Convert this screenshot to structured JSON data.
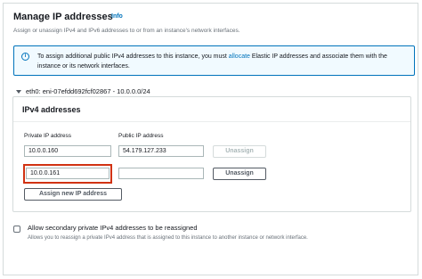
{
  "header": {
    "title": "Manage IP addresses",
    "info_link": "Info",
    "description": "Assign or unassign IPv4 and IPv6 addresses to or from an instance's network interfaces."
  },
  "info_alert": {
    "text_before": "To assign additional public IPv4 addresses to this instance, you must ",
    "link": "allocate",
    "text_after": " Elastic IP addresses and associate them with the instance or its network interfaces."
  },
  "network_interface": {
    "label": "eth0: eni-07efdd692fcf02867 - 10.0.0.0/24"
  },
  "ipv4": {
    "title": "IPv4 addresses",
    "private_ip_label": "Private IP address",
    "public_ip_label": "Public IP address",
    "rows": [
      {
        "private_ip": "10.0.0.160",
        "public_ip": "54.179.127.233",
        "unassign": "Unassign",
        "unassign_enabled": false
      },
      {
        "private_ip": "10.0.0.161",
        "public_ip": "",
        "unassign": "Unassign",
        "unassign_enabled": true
      }
    ],
    "assign_button": "Assign new IP address"
  },
  "reassign_option": {
    "label": "Allow secondary private IPv4 addresses to be reassigned",
    "description": "Allows you to reassign a private IPv4 address that is assigned to this instance to another instance or network interface.",
    "checked": false
  },
  "colors": {
    "accent": "#0073bb",
    "highlight": "#d13212",
    "border": "#d5dbdb"
  },
  "icons": {
    "info": "info-circle-icon",
    "expand": "caret-down-icon"
  }
}
